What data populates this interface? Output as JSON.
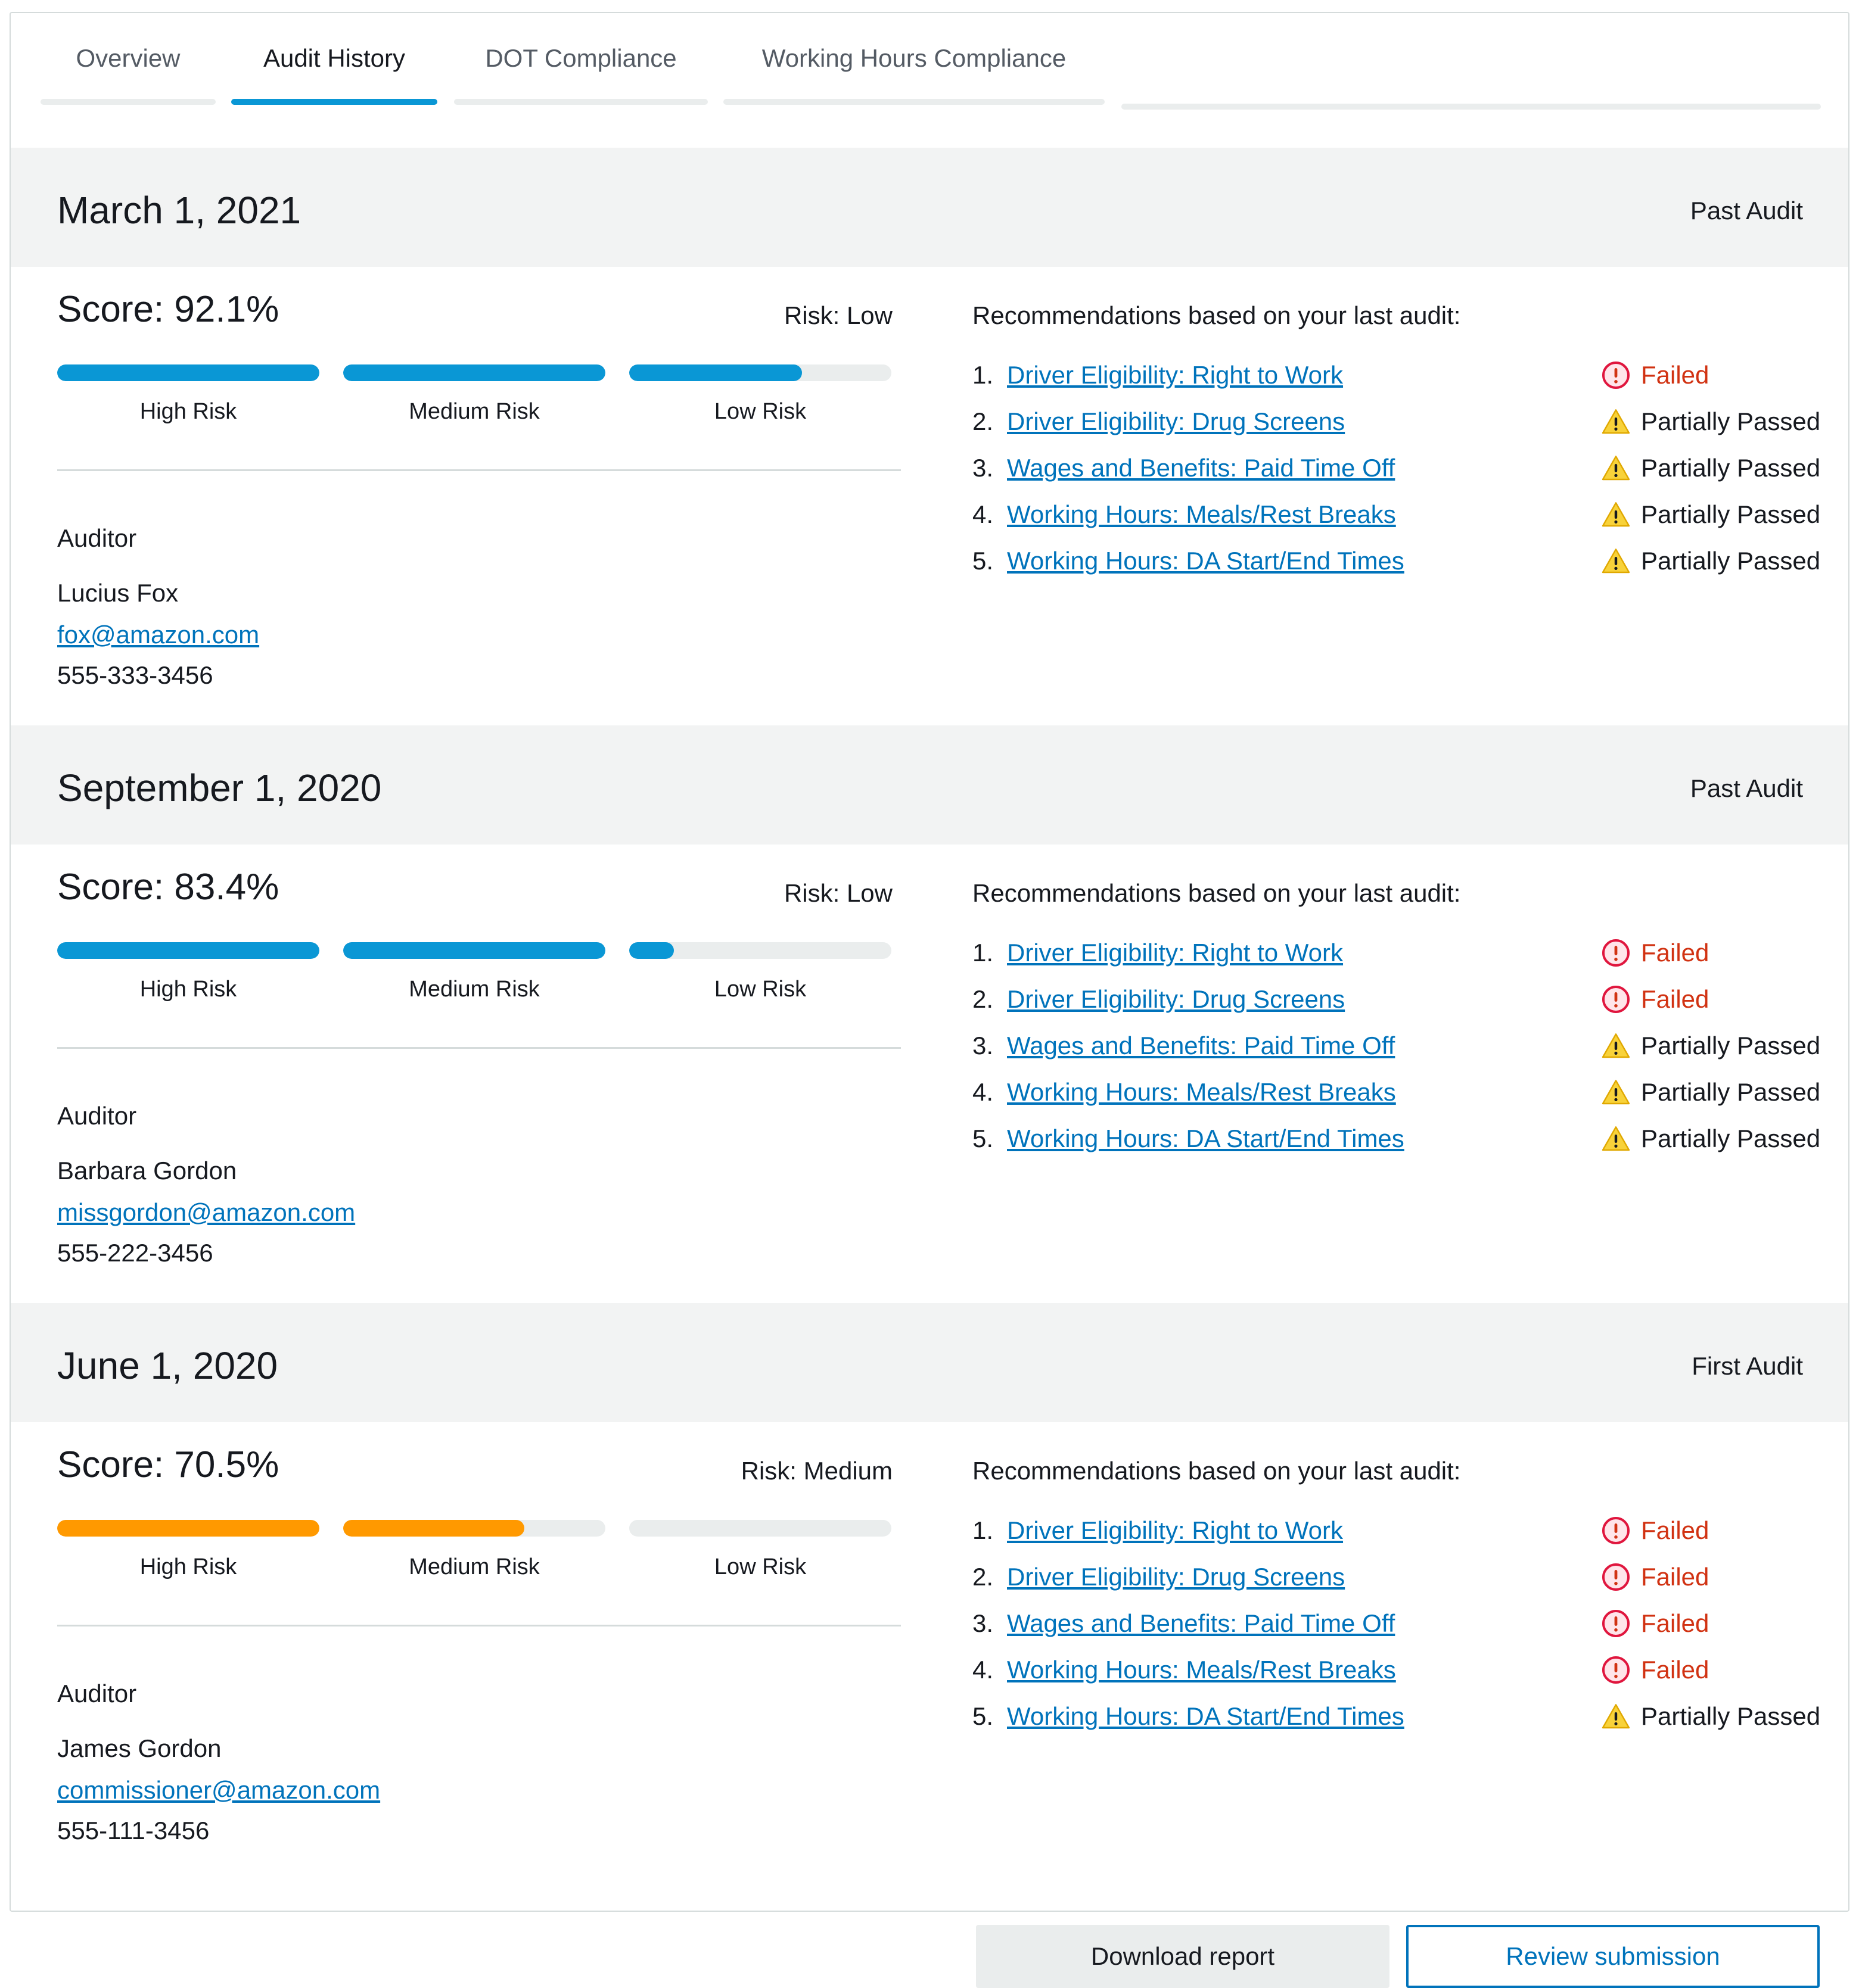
{
  "tabs": [
    "Overview",
    "Audit History",
    "DOT Compliance",
    "Working Hours Compliance"
  ],
  "colors": {
    "accent": "#0a97d5",
    "warning": "#ff9900",
    "link": "#0073bb",
    "failed": "#d13212",
    "partial": "#f2c500"
  },
  "labels": {
    "auditor": "Auditor",
    "recommendations": "Recommendations based on your last audit:",
    "download": "Download report",
    "review": "Review submission",
    "risk_levels": [
      "High Risk",
      "Medium Risk",
      "Low Risk"
    ]
  },
  "audits": [
    {
      "date": "March 1, 2021",
      "type": "Past Audit",
      "score": "Score: 92.1%",
      "risk": "Risk: Low",
      "risk_fill": [
        1.0,
        1.0,
        0.66
      ],
      "risk_color": "#0a97d5",
      "auditor_name": "Lucius Fox",
      "auditor_email": "fox@amazon.com",
      "auditor_phone": "555-333-3456",
      "recommendations": [
        {
          "num": "1.",
          "title": "Driver Eligibility: Right to Work",
          "status": "Failed",
          "type": "failed"
        },
        {
          "num": "2.",
          "title": "Driver Eligibility: Drug Screens",
          "status": "Partially Passed",
          "type": "partial"
        },
        {
          "num": "3.",
          "title": "Wages and Benefits: Paid Time Off",
          "status": "Partially Passed",
          "type": "partial"
        },
        {
          "num": "4.",
          "title": "Working Hours: Meals/Rest Breaks",
          "status": "Partially Passed",
          "type": "partial"
        },
        {
          "num": "5.",
          "title": "Working Hours: DA Start/End Times",
          "status": "Partially Passed",
          "type": "partial"
        }
      ]
    },
    {
      "date": "September 1, 2020",
      "type": "Past Audit",
      "score": "Score: 83.4%",
      "risk": "Risk: Low",
      "risk_fill": [
        1.0,
        1.0,
        0.17
      ],
      "risk_color": "#0a97d5",
      "auditor_name": "Barbara Gordon",
      "auditor_email": "missgordon@amazon.com",
      "auditor_phone": "555-222-3456",
      "recommendations": [
        {
          "num": "1.",
          "title": "Driver Eligibility: Right to Work",
          "status": "Failed",
          "type": "failed"
        },
        {
          "num": "2.",
          "title": "Driver Eligibility: Drug Screens",
          "status": "Failed",
          "type": "failed"
        },
        {
          "num": "3.",
          "title": "Wages and Benefits: Paid Time Off",
          "status": "Partially Passed",
          "type": "partial"
        },
        {
          "num": "4.",
          "title": "Working Hours: Meals/Rest Breaks",
          "status": "Partially Passed",
          "type": "partial"
        },
        {
          "num": "5.",
          "title": "Working Hours: DA Start/End Times",
          "status": "Partially Passed",
          "type": "partial"
        }
      ]
    },
    {
      "date": "June 1, 2020",
      "type": "First Audit",
      "score": "Score: 70.5%",
      "risk": "Risk: Medium",
      "risk_fill": [
        1.0,
        0.69,
        0.0
      ],
      "risk_color": "#ff9900",
      "auditor_name": "James Gordon",
      "auditor_email": "commissioner@amazon.com",
      "auditor_phone": "555-111-3456",
      "recommendations": [
        {
          "num": "1.",
          "title": "Driver Eligibility: Right to Work",
          "status": "Failed",
          "type": "failed"
        },
        {
          "num": "2.",
          "title": "Driver Eligibility: Drug Screens",
          "status": "Failed",
          "type": "failed"
        },
        {
          "num": "3.",
          "title": "Wages and Benefits: Paid Time Off",
          "status": "Failed",
          "type": "failed"
        },
        {
          "num": "4.",
          "title": "Working Hours: Meals/Rest Breaks",
          "status": "Failed",
          "type": "failed"
        },
        {
          "num": "5.",
          "title": "Working Hours: DA Start/End Times",
          "status": "Partially Passed",
          "type": "partial"
        }
      ]
    }
  ]
}
